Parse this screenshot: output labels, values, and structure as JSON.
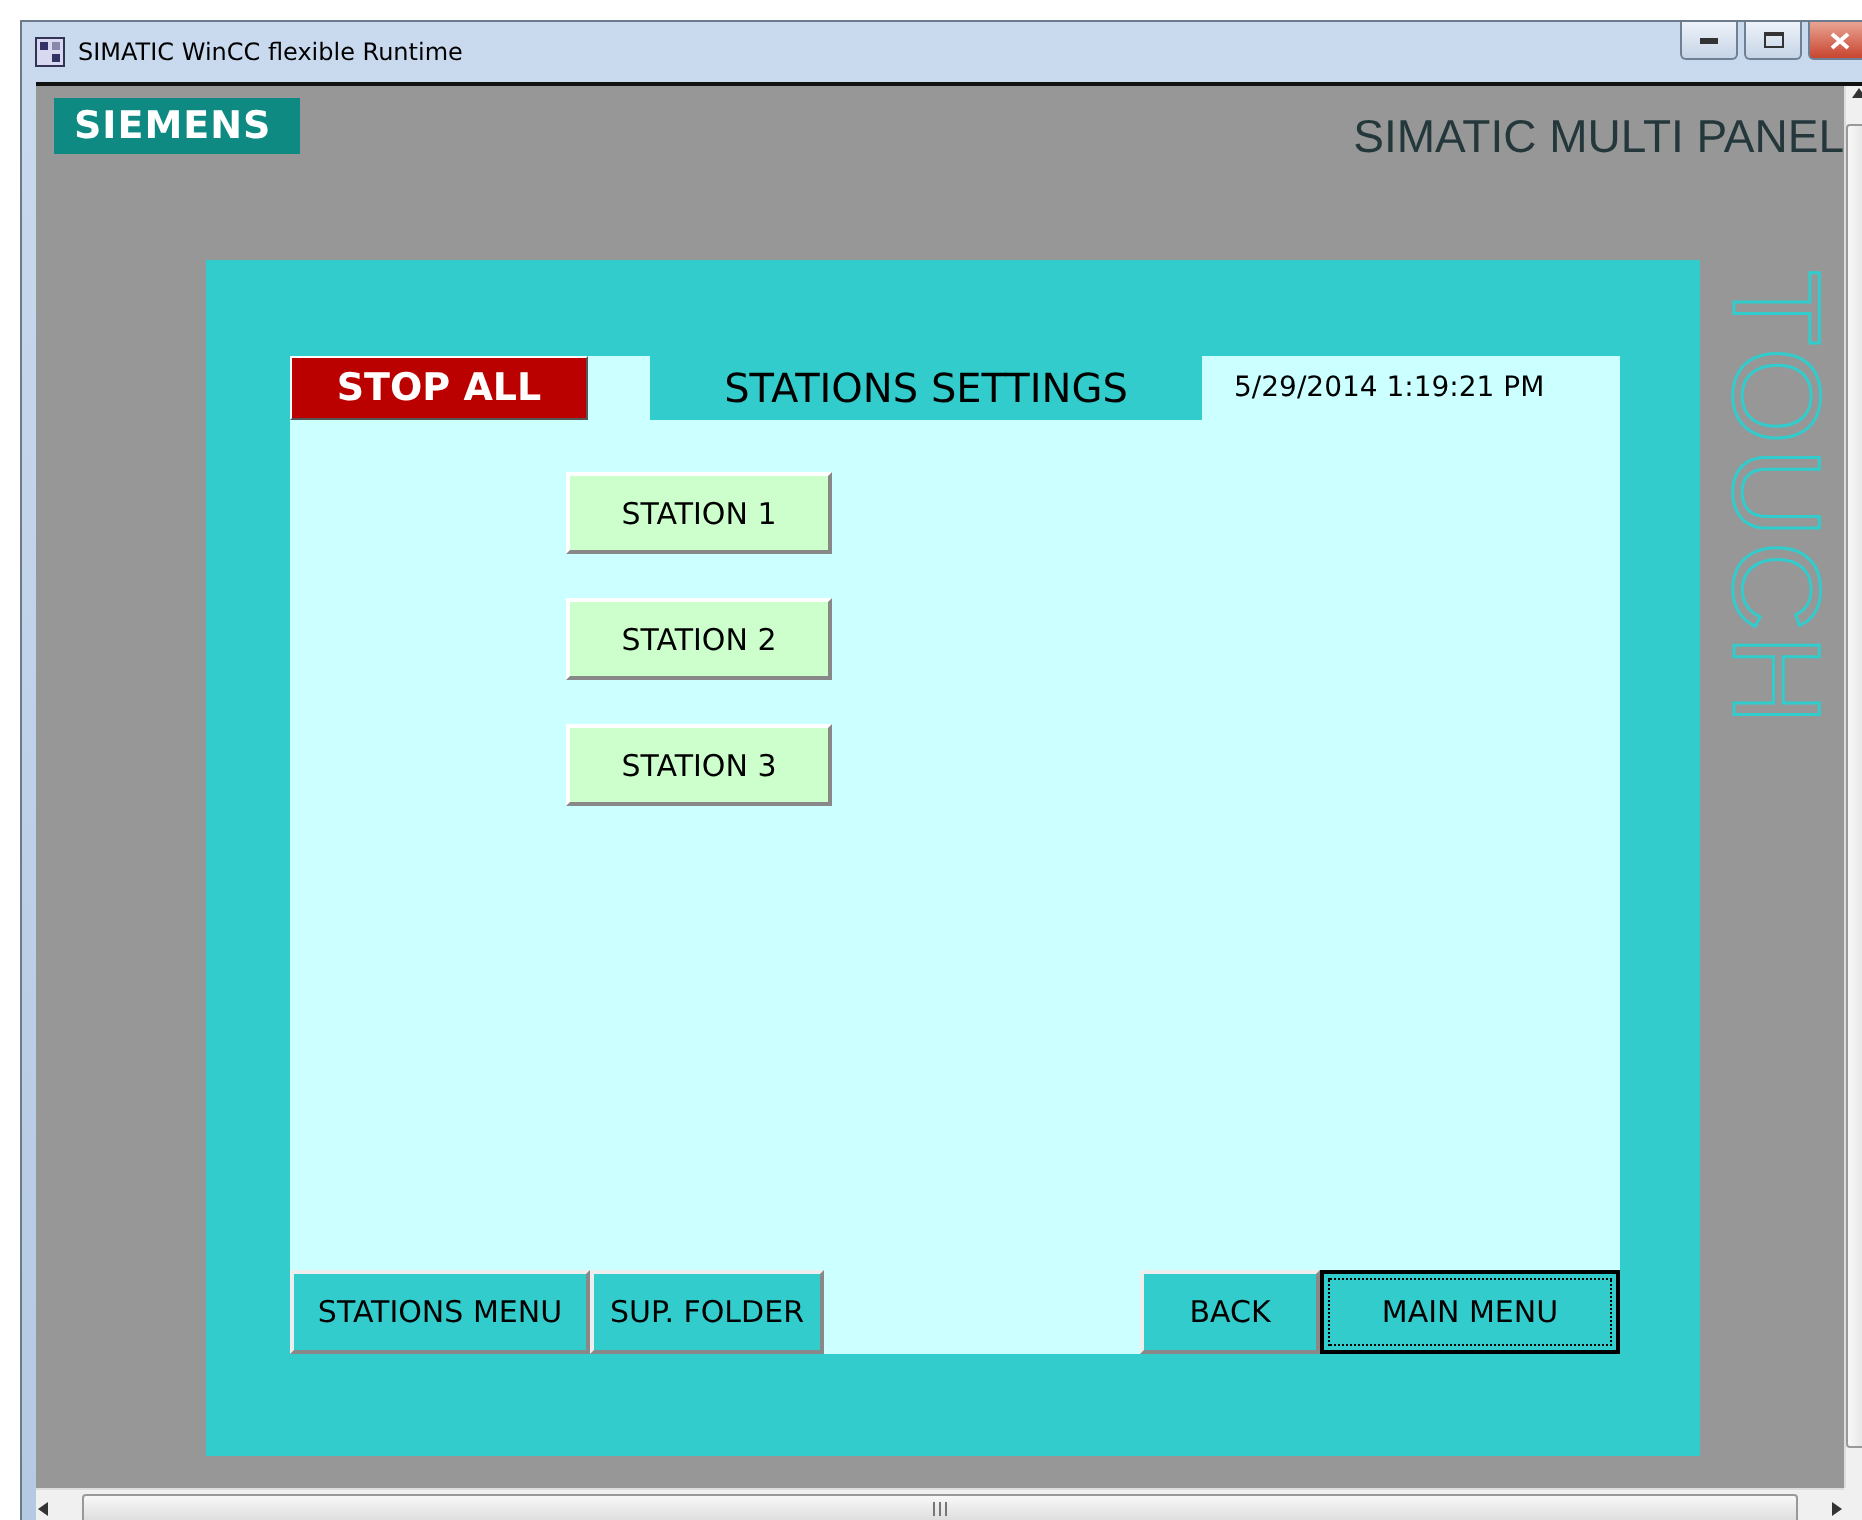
{
  "window": {
    "title": "SIMATIC WinCC flexible Runtime"
  },
  "panel": {
    "brand": "SIEMENS",
    "model": "SIMATIC MULTI PANEL",
    "side_label": "TOUCH"
  },
  "screen": {
    "stop_button": "STOP ALL",
    "title": "STATIONS SETTINGS",
    "datetime": "5/29/2014 1:19:21 PM",
    "stations": [
      {
        "label": "STATION 1"
      },
      {
        "label": "STATION 2"
      },
      {
        "label": "STATION 3"
      }
    ],
    "nav_left": [
      {
        "label": "STATIONS MENU",
        "focused": false
      },
      {
        "label": "SUP. FOLDER",
        "focused": false
      }
    ],
    "nav_right": [
      {
        "label": "BACK",
        "focused": false
      },
      {
        "label": "MAIN MENU",
        "focused": true
      }
    ]
  }
}
